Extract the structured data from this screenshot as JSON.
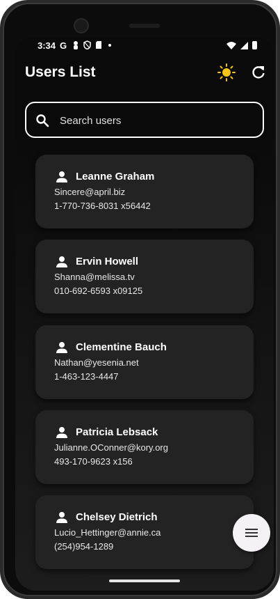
{
  "status_bar": {
    "time": "3:34",
    "left_icons": [
      "google-g-icon",
      "person-pin-icon",
      "shield-icon",
      "sd-card-icon",
      "dot-icon"
    ],
    "right_icons": [
      "wifi-icon",
      "cellular-icon",
      "battery-icon"
    ]
  },
  "app_bar": {
    "title": "Users List",
    "actions": [
      {
        "icon": "sun-icon",
        "color": "#F5C518"
      },
      {
        "icon": "refresh-icon"
      }
    ]
  },
  "search": {
    "placeholder": "Search users",
    "value": ""
  },
  "users": [
    {
      "name": "Leanne Graham",
      "email": "Sincere@april.biz",
      "phone": "1-770-736-8031 x56442"
    },
    {
      "name": "Ervin Howell",
      "email": "Shanna@melissa.tv",
      "phone": "010-692-6593 x09125"
    },
    {
      "name": "Clementine Bauch",
      "email": "Nathan@yesenia.net",
      "phone": "1-463-123-4447"
    },
    {
      "name": "Patricia Lebsack",
      "email": "Julianne.OConner@kory.org",
      "phone": "493-170-9623 x156"
    },
    {
      "name": "Chelsey Dietrich",
      "email": "Lucio_Hettinger@annie.ca",
      "phone": "(254)954-1289"
    }
  ],
  "fab": {
    "icon": "menu-icon"
  },
  "colors": {
    "background": "#0a0a0a",
    "card": "#232323",
    "text": "#ffffff",
    "sun": "#F5C518",
    "fab": "#f6f1f6"
  }
}
